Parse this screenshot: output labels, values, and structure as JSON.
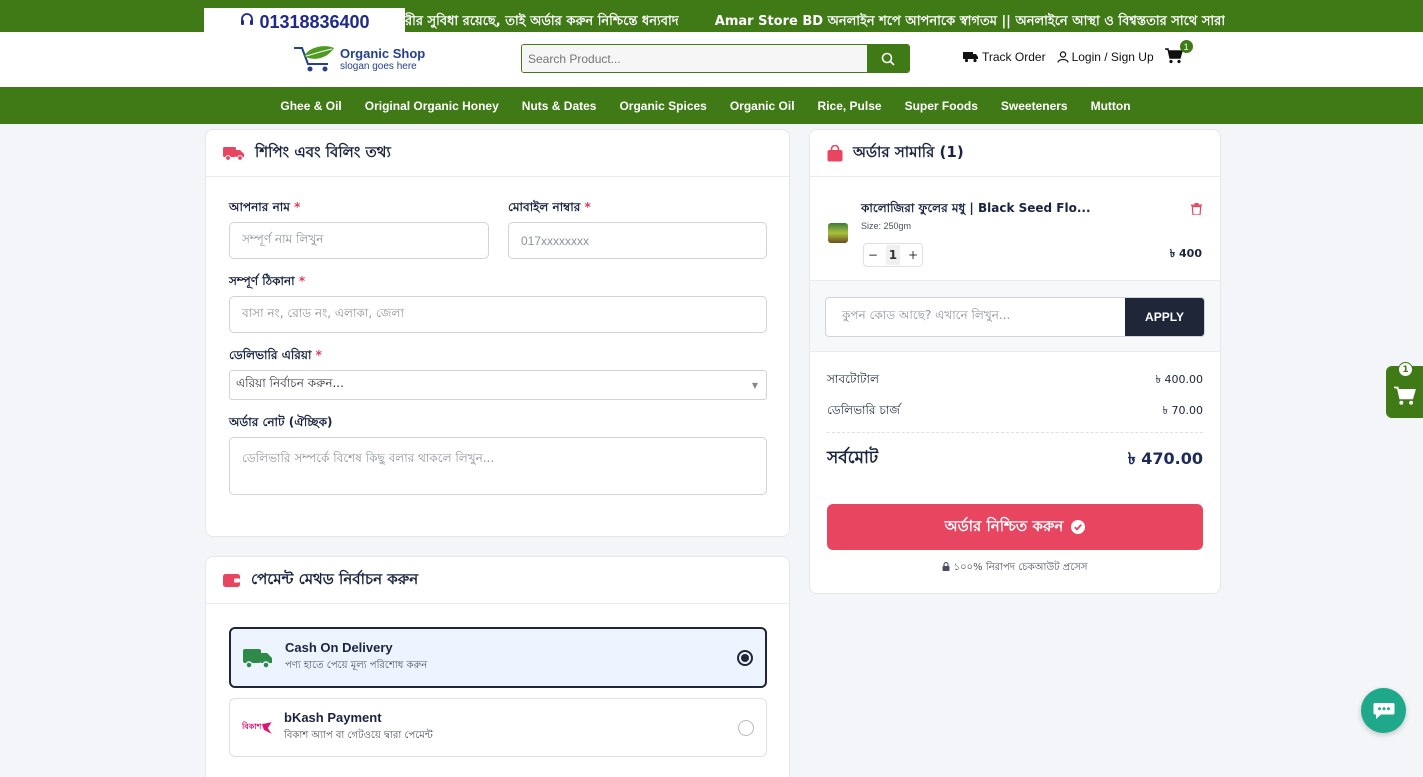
{
  "topbar": {
    "phone": "01318836400",
    "marquee": "রীর সুবিধা রয়েছে, তাই অর্ডার করুন নিশ্চিন্তে ধন্যবাদ        Amar Store BD অনলাইন শপে আপনাকে স্বাগতম || অনলাইনে আস্থা ও বিশ্বস্ততার সাথে সারা বাংলাদে"
  },
  "header": {
    "logo_title": "Organic Shop",
    "logo_slogan": "slogan goes here",
    "search_placeholder": "Search Product...",
    "track_order": "Track Order",
    "login": "Login / Sign Up",
    "cart_count": "1"
  },
  "nav": [
    "Ghee & Oil",
    "Original Organic Honey",
    "Nuts & Dates",
    "Organic Spices",
    "Organic Oil",
    "Rice, Pulse",
    "Super Foods",
    "Sweeteners",
    "Mutton"
  ],
  "shipping": {
    "title": "শিপিং এবং বিলিং তথ্য",
    "name_label": "আপনার নাম",
    "name_placeholder": "সম্পূর্ণ নাম লিখুন",
    "mobile_label": "মোবাইল নাম্বার",
    "mobile_placeholder": "017xxxxxxxx",
    "address_label": "সম্পূর্ণ ঠিকানা",
    "address_placeholder": "বাসা নং, রোড নং, এলাকা, জেলা",
    "area_label": "ডেলিভারি এরিয়া",
    "area_value": "এরিয়া নির্বাচন করুন...",
    "note_label": "অর্ডার নোট (ঐচ্ছিক)",
    "note_placeholder": "ডেলিভারি সম্পর্কে বিশেষ কিছু বলার থাকলে লিখুন...",
    "req": "*"
  },
  "payment": {
    "title": "পেমেন্ট মেথড নির্বাচন করুন",
    "options": [
      {
        "title": "Cash On Delivery",
        "subtitle": "পণ্য হাতে পেয়ে মূল্য পরিশোধ করুন",
        "selected": true
      },
      {
        "title": "bKash Payment",
        "subtitle": "বিকাশ অ্যাপ বা গেটওয়ে দ্বারা পেমেন্ট",
        "selected": false,
        "logo_text": "বিকাশ"
      }
    ]
  },
  "summary": {
    "title": "অর্ডার সামারি (1)",
    "item_name": "কালোজিরা ফুলের মধু | Black Seed Flo...",
    "item_size": "Size: 250gm",
    "qty": "1",
    "qty_minus": "−",
    "qty_plus": "+",
    "item_price": "৳ 400",
    "coupon_placeholder": "কুপন কোড আছে? এখানে লিখুন...",
    "apply": "APPLY",
    "subtotal_label": "সাবটোটাল",
    "subtotal_value": "৳ 400.00",
    "delivery_label": "ডেলিভারি চার্জ",
    "delivery_value": "৳ 70.00",
    "total_label": "সর্বমোট",
    "total_value": "৳ 470.00",
    "confirm": "অর্ডার নিশ্চিত করুন",
    "secure": "১০০% নিরাপদ চেকআউট প্রসেস"
  },
  "float_cart_count": "1",
  "colors": {
    "brand_green": "#3f7a16",
    "accent_red": "#e84560",
    "navy": "#1e2638"
  }
}
